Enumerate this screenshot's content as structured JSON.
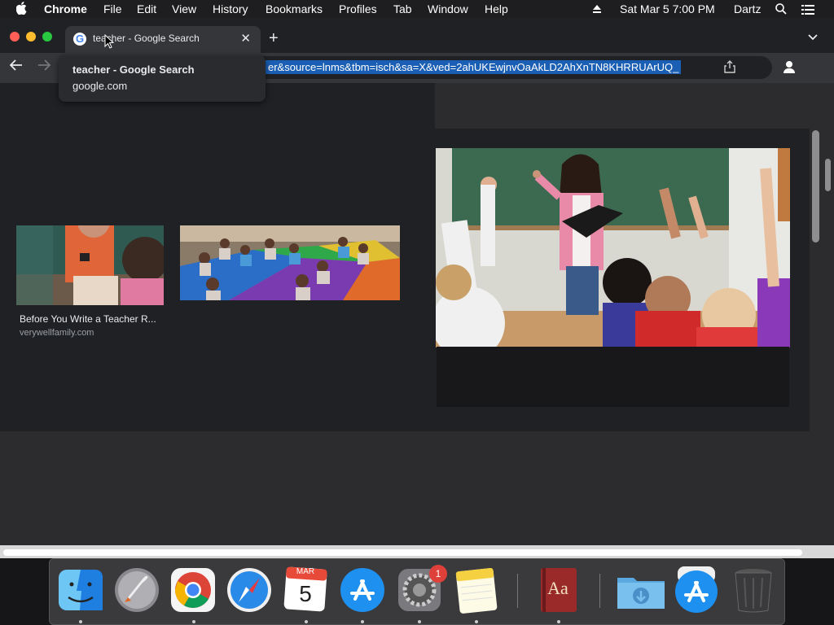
{
  "menubar": {
    "apple_icon": "apple-logo",
    "app_name": "Chrome",
    "items": [
      "File",
      "Edit",
      "View",
      "History",
      "Bookmarks",
      "Profiles",
      "Tab",
      "Window",
      "Help"
    ],
    "clock": "Sat Mar 5  7:00 PM",
    "user": "Dartz"
  },
  "tab": {
    "title": "teacher - Google Search",
    "close_icon": "close-icon"
  },
  "toolbar": {
    "url": "er&source=lnms&tbm=isch&sa=X&ved=2ahUKEwjnvOaAkLD2AhXnTN8KHRRUArUQ_"
  },
  "tooltip": {
    "title": "teacher - Google Search",
    "domain": "google.com"
  },
  "results": [
    {
      "caption": "Before You Write a Teacher R...",
      "source": "verywellfamily.com"
    }
  ],
  "dock": {
    "calendar_month": "MAR",
    "calendar_day": "5",
    "dictionary_text": "Aa",
    "badge_count": "1"
  },
  "colors": {
    "page_bg": "#202124",
    "selection": "#1a5fb4",
    "badge": "#e0403a"
  }
}
